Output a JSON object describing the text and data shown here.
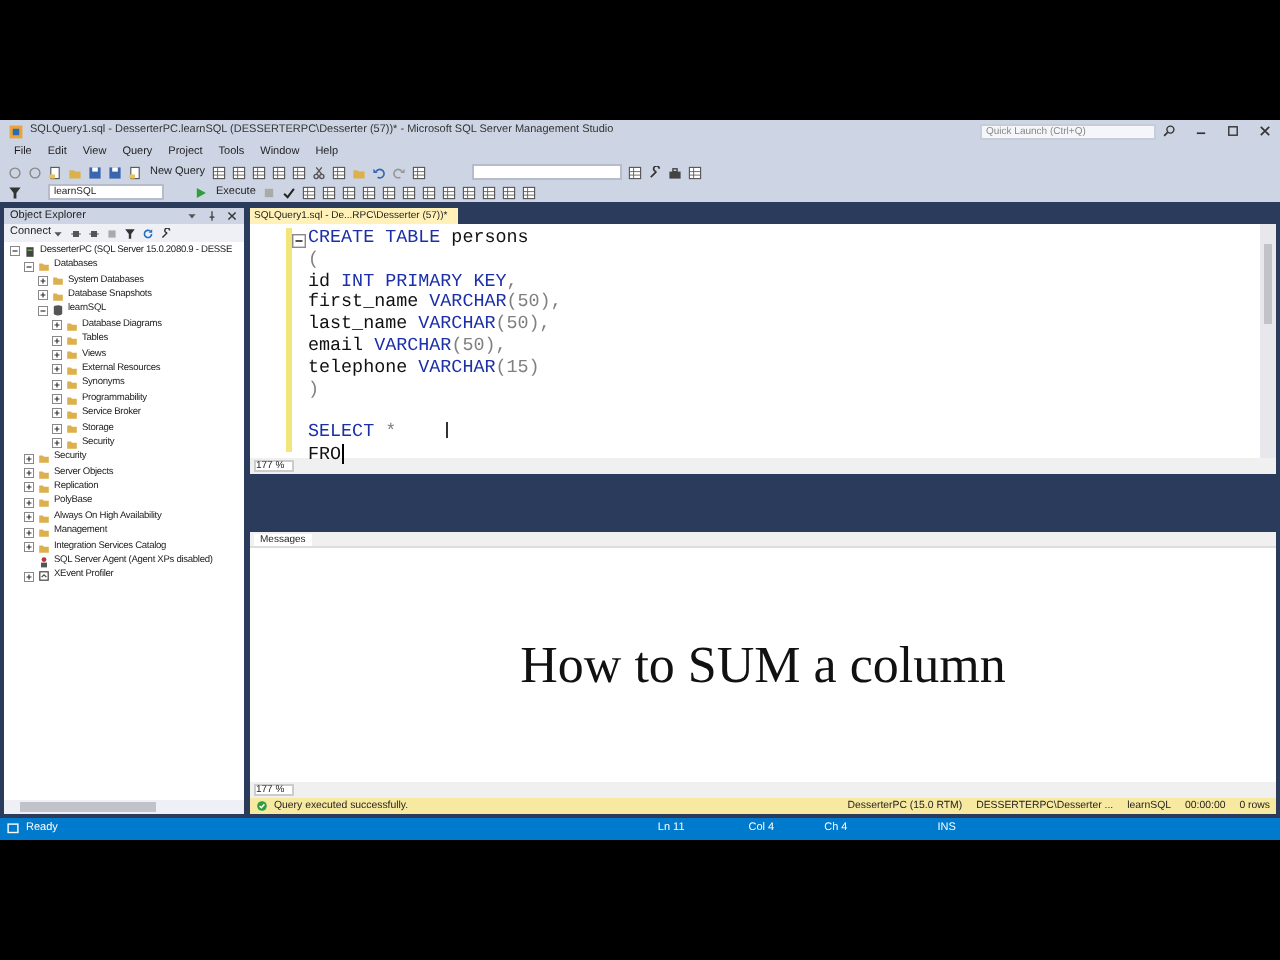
{
  "window": {
    "title": "SQLQuery1.sql - DesserterPC.learnSQL (DESSERTERPC\\Desserter (57))* - Microsoft SQL Server Management Studio",
    "quick_launch": {
      "placeholder": "Quick Launch (Ctrl+Q)"
    }
  },
  "menu": [
    "File",
    "Edit",
    "View",
    "Query",
    "Project",
    "Tools",
    "Window",
    "Help"
  ],
  "toolbar": {
    "new_query": "New Query",
    "database": "learnSQL",
    "execute": "Execute"
  },
  "object_explorer": {
    "title": "Object Explorer",
    "connect": "Connect",
    "tree": [
      {
        "label": "DesserterPC (SQL Server 15.0.2080.9 - DESSE",
        "kind": "server",
        "expanded": true,
        "children": [
          {
            "label": "Databases",
            "kind": "folder",
            "expanded": true,
            "children": [
              {
                "label": "System Databases",
                "kind": "folder",
                "expanded": false
              },
              {
                "label": "Database Snapshots",
                "kind": "folder",
                "expanded": false
              },
              {
                "label": "learnSQL",
                "kind": "database",
                "expanded": true,
                "children": [
                  {
                    "label": "Database Diagrams",
                    "kind": "folder",
                    "expanded": false
                  },
                  {
                    "label": "Tables",
                    "kind": "folder",
                    "expanded": false
                  },
                  {
                    "label": "Views",
                    "kind": "folder",
                    "expanded": false
                  },
                  {
                    "label": "External Resources",
                    "kind": "folder",
                    "expanded": false
                  },
                  {
                    "label": "Synonyms",
                    "kind": "folder",
                    "expanded": false
                  },
                  {
                    "label": "Programmability",
                    "kind": "folder",
                    "expanded": false
                  },
                  {
                    "label": "Service Broker",
                    "kind": "folder",
                    "expanded": false
                  },
                  {
                    "label": "Storage",
                    "kind": "folder",
                    "expanded": false
                  },
                  {
                    "label": "Security",
                    "kind": "folder",
                    "expanded": false
                  }
                ]
              }
            ]
          },
          {
            "label": "Security",
            "kind": "folder",
            "expanded": false
          },
          {
            "label": "Server Objects",
            "kind": "folder",
            "expanded": false
          },
          {
            "label": "Replication",
            "kind": "folder",
            "expanded": false
          },
          {
            "label": "PolyBase",
            "kind": "folder",
            "expanded": false
          },
          {
            "label": "Always On High Availability",
            "kind": "folder",
            "expanded": false
          },
          {
            "label": "Management",
            "kind": "folder",
            "expanded": false
          },
          {
            "label": "Integration Services Catalog",
            "kind": "folder",
            "expanded": false
          },
          {
            "label": "SQL Server Agent (Agent XPs disabled)",
            "kind": "agent"
          },
          {
            "label": "XEvent Profiler",
            "kind": "profiler",
            "expanded": false
          }
        ]
      }
    ]
  },
  "editor": {
    "tab": "SQLQuery1.sql - De...RPC\\Desserter (57))*",
    "zoom": "177 %",
    "lines": [
      {
        "kind": "code",
        "tokens": [
          {
            "t": "CREATE TABLE",
            "kind": "keyword"
          },
          {
            "t": " persons",
            "kind": "plain"
          }
        ]
      },
      {
        "kind": "code",
        "tokens": [
          {
            "t": "(",
            "kind": "punct"
          }
        ]
      },
      {
        "kind": "code",
        "tokens": [
          {
            "t": "id ",
            "kind": "plain"
          },
          {
            "t": "INT PRIMARY KEY",
            "kind": "keyword"
          },
          {
            "t": ",",
            "kind": "punct"
          }
        ]
      },
      {
        "kind": "code",
        "tokens": [
          {
            "t": "first_name ",
            "kind": "plain"
          },
          {
            "t": "VARCHAR",
            "kind": "keyword"
          },
          {
            "t": "(50),",
            "kind": "punct"
          }
        ]
      },
      {
        "kind": "code",
        "tokens": [
          {
            "t": "last_name ",
            "kind": "plain"
          },
          {
            "t": "VARCHAR",
            "kind": "keyword"
          },
          {
            "t": "(50),",
            "kind": "punct"
          }
        ]
      },
      {
        "kind": "code",
        "tokens": [
          {
            "t": "email ",
            "kind": "plain"
          },
          {
            "t": "VARCHAR",
            "kind": "keyword"
          },
          {
            "t": "(50),",
            "kind": "punct"
          }
        ]
      },
      {
        "kind": "code",
        "tokens": [
          {
            "t": "telephone ",
            "kind": "plain"
          },
          {
            "t": "VARCHAR",
            "kind": "keyword"
          },
          {
            "t": "(15)",
            "kind": "punct"
          }
        ]
      },
      {
        "kind": "code",
        "tokens": [
          {
            "t": ")",
            "kind": "punct"
          }
        ]
      },
      {
        "kind": "blank"
      },
      {
        "kind": "code",
        "tokens": [
          {
            "t": "SELECT ",
            "kind": "keyword"
          },
          {
            "t": "*",
            "kind": "punct"
          }
        ]
      },
      {
        "kind": "code",
        "tokens": [
          {
            "t": "FRO",
            "kind": "plain"
          }
        ]
      }
    ]
  },
  "results": {
    "tab": "Messages",
    "caption": "How to SUM a column",
    "zoom": "177 %",
    "status": {
      "message": "Query executed successfully.",
      "server": "DesserterPC (15.0 RTM)",
      "user": "DESSERTERPC\\Desserter ...",
      "database": "learnSQL",
      "time": "00:00:00",
      "rows": "0 rows"
    }
  },
  "status_bar": {
    "state": "Ready",
    "line": "Ln 11",
    "col": "Col 4",
    "ch": "Ch 4",
    "mode": "INS"
  }
}
